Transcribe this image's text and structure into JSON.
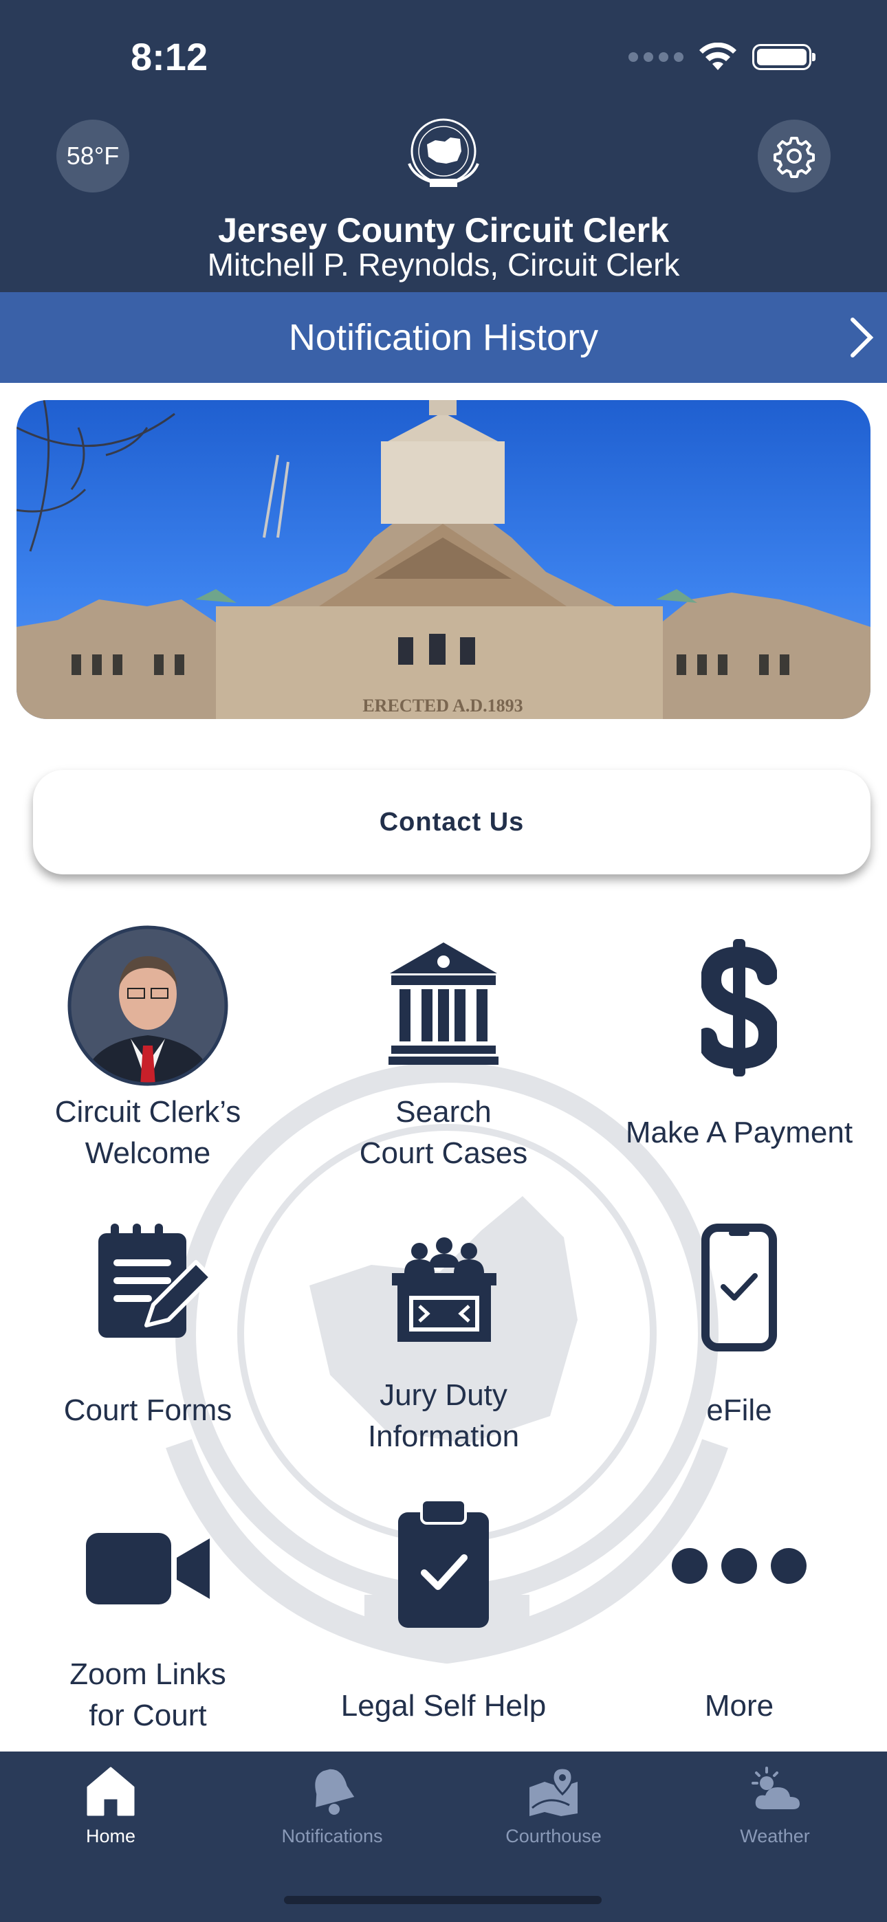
{
  "status_bar": {
    "time": "8:12"
  },
  "header": {
    "temperature": "58°F",
    "title": "Jersey County Circuit Clerk",
    "subtitle": "Mitchell P. Reynolds, Circuit Clerk"
  },
  "notification_bar": {
    "label": "Notification History"
  },
  "hero": {
    "engraving": "ERECTED A.D.1893"
  },
  "contact": {
    "label": "Contact Us"
  },
  "grid": [
    {
      "line1": "Circuit Clerk’s",
      "line2": "Welcome",
      "icon": "person-photo"
    },
    {
      "line1": "Search",
      "line2": "Court Cases",
      "icon": "courthouse-icon"
    },
    {
      "line1": "Make A Payment",
      "line2": "",
      "icon": "dollar-icon"
    },
    {
      "line1": "Court Forms",
      "line2": "",
      "icon": "document-pen-icon"
    },
    {
      "line1": "Jury Duty",
      "line2": "Information",
      "icon": "jury-box-icon"
    },
    {
      "line1": "eFile",
      "line2": "",
      "icon": "phone-check-icon"
    },
    {
      "line1": "Zoom Links",
      "line2": "for Court",
      "icon": "video-camera-icon"
    },
    {
      "line1": "Legal Self Help",
      "line2": "",
      "icon": "clipboard-check-icon"
    },
    {
      "line1": "More",
      "line2": "",
      "icon": "ellipsis-icon"
    }
  ],
  "tabs": [
    {
      "label": "Home",
      "icon": "home-icon",
      "active": true
    },
    {
      "label": "Notifications",
      "icon": "bell-icon",
      "active": false
    },
    {
      "label": "Courthouse",
      "icon": "map-pin-icon",
      "active": false
    },
    {
      "label": "Weather",
      "icon": "weather-icon",
      "active": false
    }
  ],
  "colors": {
    "navy": "#2a3b59",
    "blue_bar": "#3a61a8",
    "icon_navy": "#22304b"
  }
}
